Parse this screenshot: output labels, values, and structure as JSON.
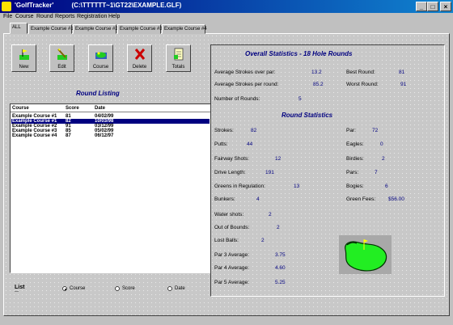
{
  "window": {
    "title": "'GolfTracker'",
    "path": "(C:\\TTTTTT~1\\GT22\\EXAMPLE.GLF)"
  },
  "menu": [
    "File",
    "Course",
    "Round",
    "Reports",
    "Registration",
    "Help"
  ],
  "tabs": [
    "ALL",
    "Example Course #1",
    "Example Course #2",
    "Example Course #3",
    "Example Course #4"
  ],
  "toolbar": [
    {
      "label": "New",
      "icon": "new-flag-icon"
    },
    {
      "label": "Edit",
      "icon": "edit-pencil-icon"
    },
    {
      "label": "Course",
      "icon": "course-icon"
    },
    {
      "label": "Delete",
      "icon": "delete-x-icon"
    },
    {
      "label": "Totals",
      "icon": "totals-notepad-icon"
    }
  ],
  "round_listing": {
    "heading": "Round Listing",
    "columns": [
      "Course",
      "Score",
      "Date"
    ],
    "rows": [
      [
        "Example Course #1",
        "81",
        "04/02/99"
      ],
      [
        "Example Course #1",
        "82",
        "10/03/98"
      ],
      [
        "Example Course #2",
        "91",
        "03/12/99"
      ],
      [
        "Example Course #3",
        "85",
        "05/02/99"
      ],
      [
        "Example Course #4",
        "87",
        "06/12/97"
      ]
    ],
    "selected_row": 1
  },
  "list_sort": {
    "label": "List",
    "options": [
      "Course",
      "Score",
      "Date"
    ],
    "selected": "Course"
  },
  "overall": {
    "heading": "Overall Statistics - 18 Hole Rounds",
    "avg_over_par_label": "Average Strokes over par:",
    "avg_over_par": "13.2",
    "avg_per_round_label": "Average Strokes per round:",
    "avg_per_round": "85.2",
    "num_rounds_label": "Number of Rounds:",
    "num_rounds": "5",
    "best_round_label": "Best Round:",
    "best_round": "81",
    "worst_round_label": "Worst Round:",
    "worst_round": "91"
  },
  "round_stats": {
    "heading": "Round Statistics",
    "left": [
      {
        "label": "Strokes:",
        "value": "82"
      },
      {
        "label": "Putts:",
        "value": "44"
      },
      {
        "label": "Fairway Shots:",
        "value": "12"
      },
      {
        "label": "Drive Length:",
        "value": "191"
      },
      {
        "label": "Greens in Regulation:",
        "value": "13"
      },
      {
        "label": "Bunkers:",
        "value": "4"
      },
      {
        "label": "Water shots:",
        "value": "2"
      },
      {
        "label": "Out of Bounds:",
        "value": "2"
      },
      {
        "label": "Lost Balls:",
        "value": "2"
      },
      {
        "label": "Par 3 Average:",
        "value": "3.75"
      },
      {
        "label": "Par 4 Average:",
        "value": "4.60"
      },
      {
        "label": "Par 5 Average:",
        "value": "5.25"
      }
    ],
    "right": [
      {
        "label": "Par:",
        "value": "72"
      },
      {
        "label": "Eagles:",
        "value": "0"
      },
      {
        "label": "Birdies:",
        "value": "2"
      },
      {
        "label": "Pars:",
        "value": "7"
      },
      {
        "label": "Bogies:",
        "value": "6"
      },
      {
        "label": "Green Fees:",
        "value": "$56.00"
      }
    ]
  },
  "colors": {
    "titlebar": "#000080",
    "accent": "#000080",
    "green": "#22cc22"
  }
}
